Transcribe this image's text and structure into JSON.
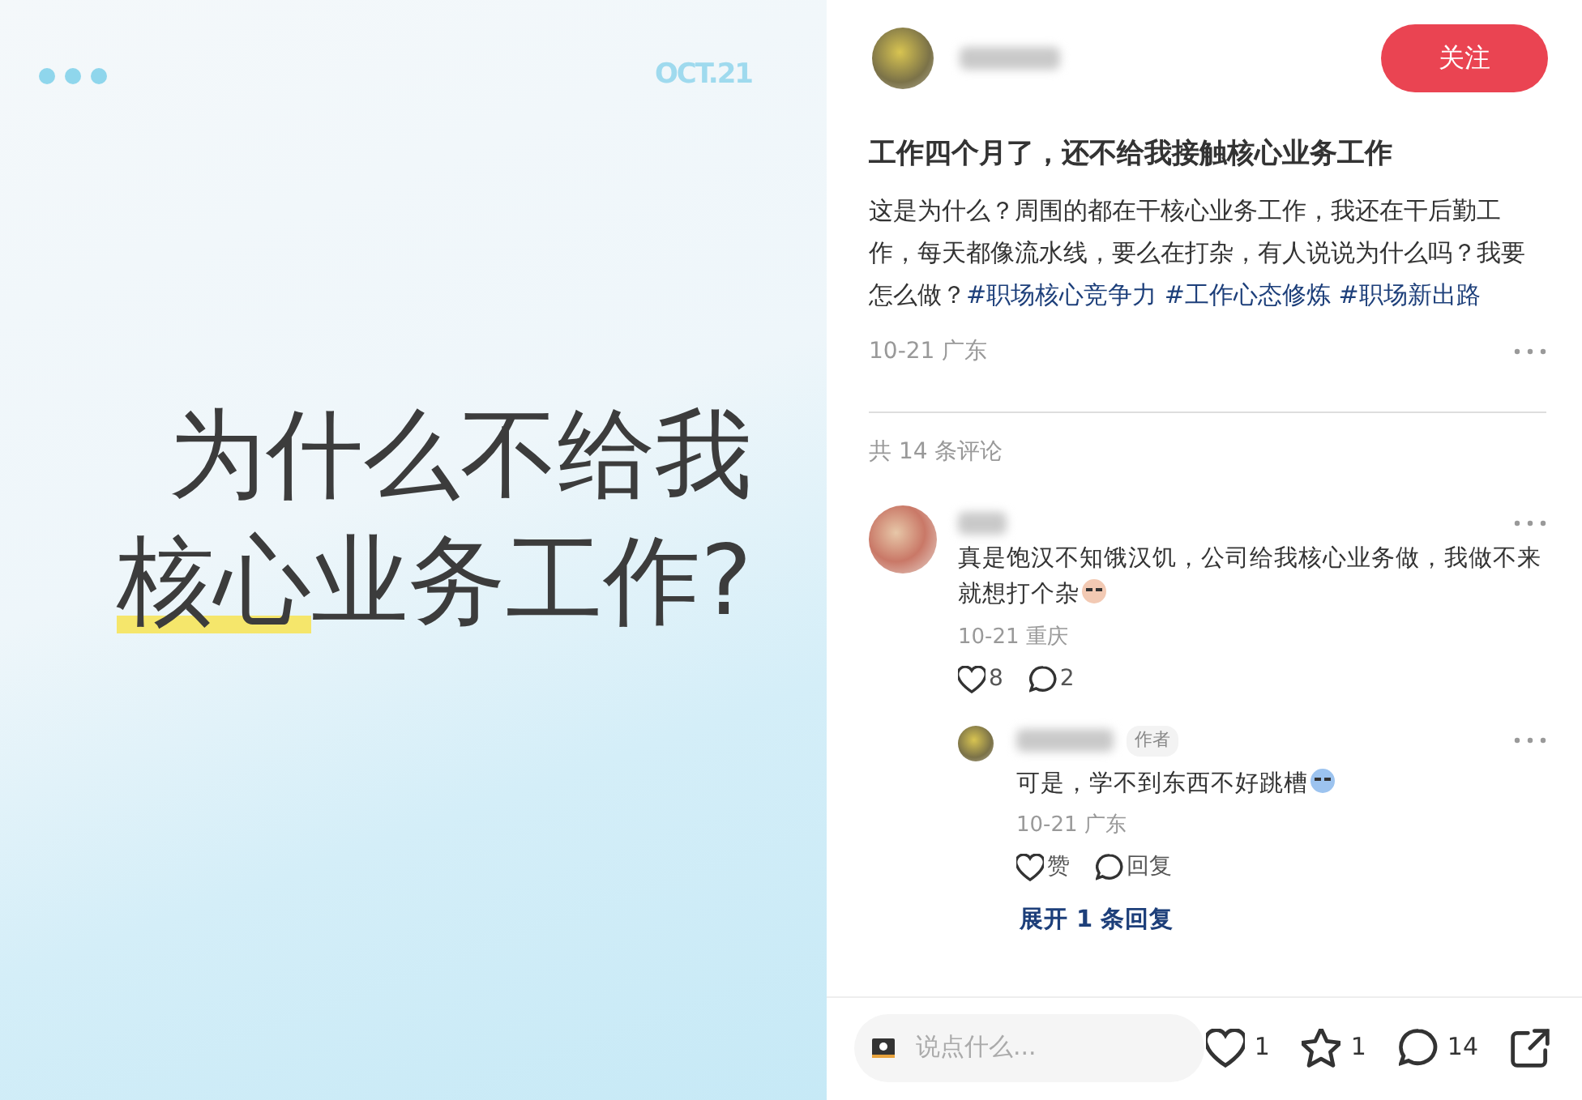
{
  "image_card": {
    "kind": "graphic",
    "date": "OCT.21",
    "headline": [
      [
        {
          "text": "为什么不给我",
          "highlighted": false
        }
      ],
      [
        {
          "text": "核心",
          "highlighted": true
        },
        {
          "text": "业务工作?",
          "highlighted": false
        }
      ]
    ]
  },
  "post": {
    "follow_button": "关注",
    "title": "工作四个月了，还不给我接触核心业务工作",
    "body": "这是为什么？周围的都在干核心业务工作，我还在干后勤工作，每天都像流水线，要么在打杂，有人说说为什么吗？我要怎么做？",
    "tags": [
      "#职场核心竞争力",
      "#工作心态修炼",
      "#职场新出路"
    ],
    "meta": "10-21 广东"
  },
  "comments_header": "共 14 条评论",
  "comments": [
    {
      "text": "真是饱汉不知饿汉饥，公司给我核心业务做，我做不来就想打个杂",
      "meta": "10-21 重庆",
      "likes": "8",
      "replies": "2",
      "children": [
        {
          "author_tag": "作者",
          "text": "可是，学不到东西不好跳槽",
          "meta": "10-21 广东",
          "like_label": "赞",
          "reply_label": "回复"
        }
      ],
      "expand": "展开 1 条回复"
    }
  ],
  "bottom_bar": {
    "placeholder": "说点什么...",
    "likes": "1",
    "stars": "1",
    "comments": "14"
  }
}
